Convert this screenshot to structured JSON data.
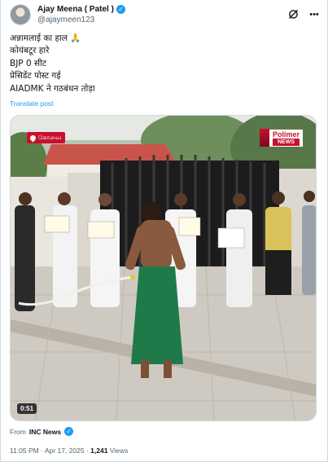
{
  "author": {
    "display_name": "Ajay Meena ( Patel )",
    "handle": "@ajaymeen123",
    "avatar_icon": "profile-photo",
    "verified_icon": "verified-badge-icon"
  },
  "header_actions": {
    "grok_icon": "grok-slash-icon",
    "more_icon": "more-dots-icon"
  },
  "tweet": {
    "lines": [
      "अन्नामलाई का हाल 🙏",
      "कोयंबटूर हारे",
      "BJP 0 सीट",
      "प्रेसिडेंट पोस्ट गई",
      "AIADMK ने गठबंधन तोड़ा"
    ],
    "translate_label": "Translate post"
  },
  "video": {
    "location_badge": "கோவை",
    "channel_logo_top": "Polimer",
    "channel_logo_bottom": "NEWS",
    "duration": "0:51",
    "badge_color": "#c8102e"
  },
  "source": {
    "prefix": "From",
    "name": "INC News"
  },
  "meta": {
    "time": "11:05 PM",
    "separator": "·",
    "date": "Apr 17, 2025",
    "views_count": "1,241",
    "views_label": "Views"
  },
  "colors": {
    "accent": "#1d9bf0",
    "text": "#0f1419",
    "muted": "#536471"
  }
}
